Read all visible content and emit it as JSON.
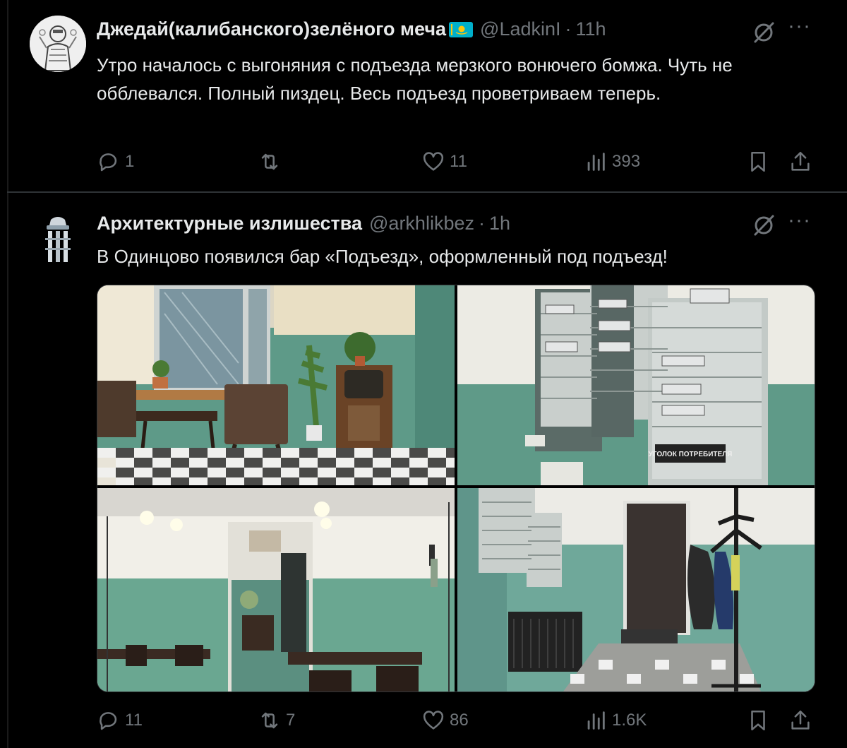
{
  "tweets": [
    {
      "author": {
        "name": "Джедай(калибанского)зелёного меча",
        "handle": "@LadkinI",
        "time": "11h",
        "flag_icon": "kazakhstan-flag-icon"
      },
      "text": "Утро началось с выгоняния с подъезда мерзкого вонючего бомжа. Чуть не обблевался. Полный пиздец. Весь подъезд проветриваем теперь.",
      "stats": {
        "replies": "1",
        "reposts": "",
        "likes": "11",
        "views": "393"
      }
    },
    {
      "author": {
        "name": "Архитектурные излишества",
        "handle": "@arkhlikbez",
        "time": "1h"
      },
      "text": "В Одинцово появился бар «Подъезд», оформленный под подъезд!",
      "media": {
        "count": 4,
        "mailbox_sign": "УГОЛОК ПОТРЕБИТЕЛЯ"
      },
      "stats": {
        "replies": "11",
        "reposts": "7",
        "likes": "86",
        "views": "1.6K"
      }
    }
  ],
  "ui": {
    "separator": "·",
    "more_label": "···",
    "colors": {
      "background": "#000000",
      "text": "#e7e9ea",
      "muted": "#71767b",
      "border": "#2f3336"
    }
  }
}
